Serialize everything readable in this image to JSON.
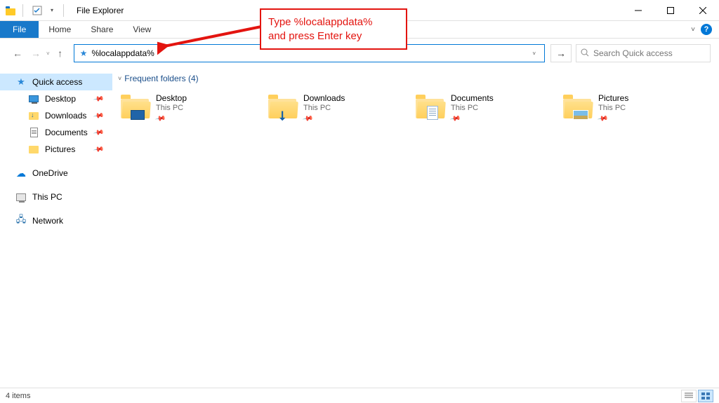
{
  "window": {
    "title": "File Explorer"
  },
  "ribbon": {
    "file": "File",
    "tabs": [
      "Home",
      "Share",
      "View"
    ]
  },
  "address": {
    "value": "%localappdata%"
  },
  "search": {
    "placeholder": "Search Quick access"
  },
  "navpane": {
    "quick_access": "Quick access",
    "pinned": [
      {
        "label": "Desktop"
      },
      {
        "label": "Downloads"
      },
      {
        "label": "Documents"
      },
      {
        "label": "Pictures"
      }
    ],
    "onedrive": "OneDrive",
    "thispc": "This PC",
    "network": "Network"
  },
  "main": {
    "group_header": "Frequent folders (4)",
    "tiles": [
      {
        "name": "Desktop",
        "sub": "This PC"
      },
      {
        "name": "Downloads",
        "sub": "This PC"
      },
      {
        "name": "Documents",
        "sub": "This PC"
      },
      {
        "name": "Pictures",
        "sub": "This PC"
      }
    ]
  },
  "status": {
    "text": "4 items"
  },
  "annotation": {
    "line1": "Type %localappdata%",
    "line2": "and press Enter key"
  }
}
